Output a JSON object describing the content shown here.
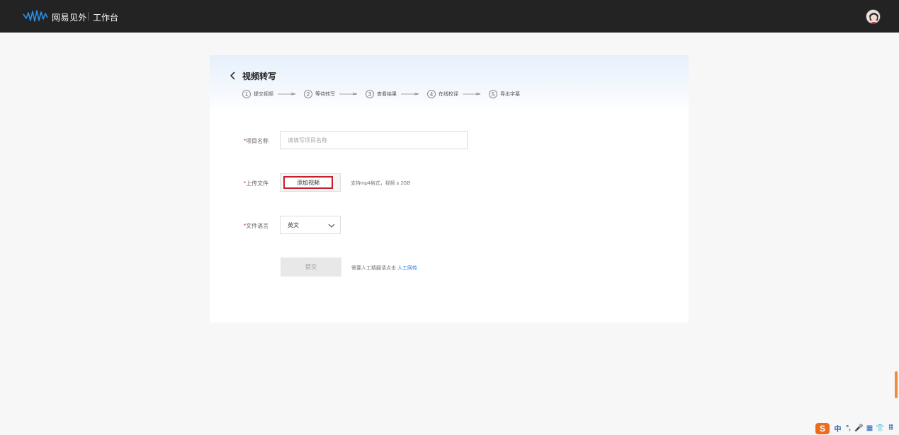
{
  "topbar": {
    "brand": "网易见外",
    "workspace": "工作台",
    "logo_icon": "wave-logo-icon",
    "avatar_icon": "user-avatar-icon"
  },
  "page": {
    "title": "视频转写",
    "back_icon": "chevron-left-icon"
  },
  "steps": [
    {
      "num": "1",
      "label": "提交视频"
    },
    {
      "num": "2",
      "label": "等待转写"
    },
    {
      "num": "3",
      "label": "查看结果"
    },
    {
      "num": "4",
      "label": "在线校译"
    },
    {
      "num": "5",
      "label": "导出字幕"
    }
  ],
  "form": {
    "project_name": {
      "required_mark": "*",
      "label": "项目名称",
      "placeholder": "请填写项目名称",
      "value": ""
    },
    "upload": {
      "required_mark": "*",
      "label": "上传文件",
      "button_label": "添加视频",
      "hint": "支持mp4格式，视频 ≤ 2GB"
    },
    "language": {
      "required_mark": "*",
      "label": "文件语言",
      "selected": "英文"
    },
    "submit_label": "提交",
    "manual_hint": "需要人工精翻请点击",
    "manual_link": "人工网传"
  },
  "ime": {
    "logo": "S",
    "items": [
      "中",
      "°,",
      "🎤",
      "▦",
      "👕",
      "⠿"
    ]
  },
  "colors": {
    "topbar": "#232323",
    "accent_red": "#c8202a",
    "link_blue": "#1e7fe0",
    "ime_orange": "#f06a1e"
  }
}
